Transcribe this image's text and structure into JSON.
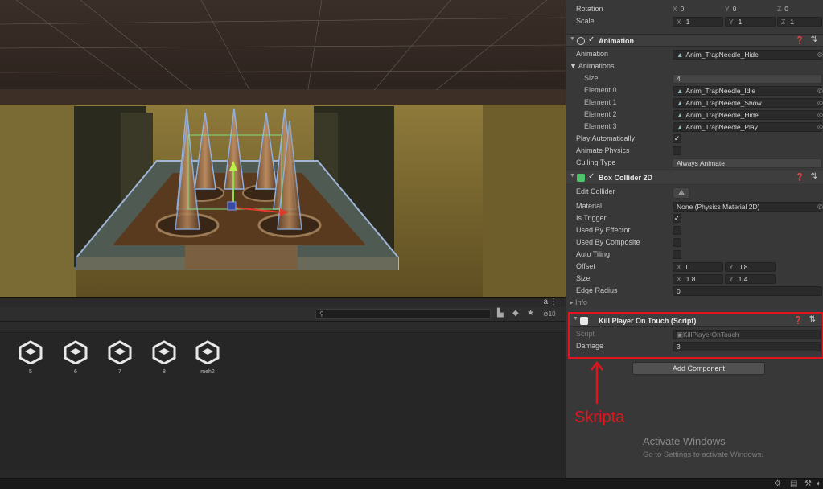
{
  "inspector": {
    "transform": {
      "rotation_label": "Rotation",
      "rotation": {
        "x": "0",
        "y": "0",
        "z": "0"
      },
      "scale_label": "Scale",
      "scale": {
        "x": "1",
        "y": "1",
        "z": "1"
      }
    },
    "animation": {
      "title": "Animation",
      "animation_label": "Animation",
      "animation_value": "Anim_TrapNeedle_Hide",
      "animations_label": "Animations",
      "size_label": "Size",
      "size_value": "4",
      "elements": [
        {
          "label": "Element 0",
          "value": "Anim_TrapNeedle_Idle"
        },
        {
          "label": "Element 1",
          "value": "Anim_TrapNeedle_Show"
        },
        {
          "label": "Element 2",
          "value": "Anim_TrapNeedle_Hide"
        },
        {
          "label": "Element 3",
          "value": "Anim_TrapNeedle_Play"
        }
      ],
      "play_auto_label": "Play Automatically",
      "animate_physics_label": "Animate Physics",
      "culling_label": "Culling Type",
      "culling_value": "Always Animate"
    },
    "box_collider": {
      "title": "Box Collider 2D",
      "edit_collider_label": "Edit Collider",
      "material_label": "Material",
      "material_value": "None (Physics Material 2D)",
      "is_trigger_label": "Is Trigger",
      "used_by_effector_label": "Used By Effector",
      "used_by_composite_label": "Used By Composite",
      "auto_tiling_label": "Auto Tiling",
      "offset_label": "Offset",
      "offset": {
        "x": "0",
        "y": "0.8"
      },
      "size_label": "Size",
      "size": {
        "x": "1.8",
        "y": "1.4"
      },
      "edge_radius_label": "Edge Radius",
      "edge_radius_value": "0",
      "info_label": "Info"
    },
    "kill_player": {
      "title": "Kill Player On Touch (Script)",
      "script_label": "Script",
      "script_value": "KillPlayerOnTouch",
      "damage_label": "Damage",
      "damage_value": "3"
    },
    "add_component_label": "Add Component"
  },
  "annotation": {
    "label": "Skripta",
    "color": "#e0151e"
  },
  "watermark": {
    "title": "Activate Windows",
    "subtitle": "Go to Settings to activate Windows."
  },
  "project": {
    "hidden_count": "10",
    "assets": [
      {
        "label": "5"
      },
      {
        "label": "6"
      },
      {
        "label": "7"
      },
      {
        "label": "8"
      },
      {
        "label": "meh2"
      }
    ]
  }
}
